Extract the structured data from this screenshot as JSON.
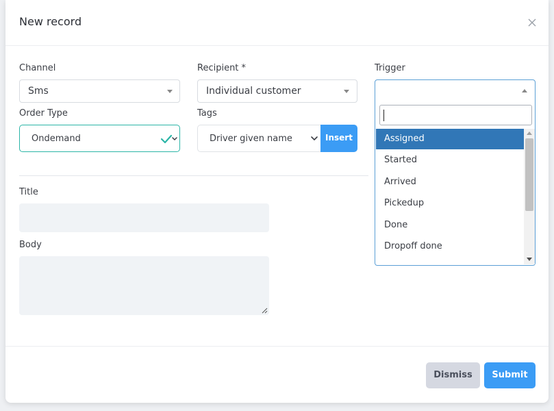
{
  "modal": {
    "title": "New record",
    "close_icon": "close-icon"
  },
  "form": {
    "channel": {
      "label": "Channel",
      "value": "Sms"
    },
    "recipient": {
      "label": "Recipient *",
      "value": "Individual customer"
    },
    "trigger": {
      "label": "Trigger",
      "value": "",
      "search_value": "",
      "options": [
        "Assigned",
        "Started",
        "Arrived",
        "Pickedup",
        "Done",
        "Dropoff done"
      ],
      "highlighted": "Assigned"
    },
    "order_type": {
      "label": "Order Type",
      "value": "Ondemand",
      "valid_icon": "check-icon"
    },
    "tags": {
      "label": "Tags",
      "value": "Driver given name",
      "insert_label": "Insert"
    },
    "title": {
      "label": "Title",
      "value": ""
    },
    "body": {
      "label": "Body",
      "value": ""
    }
  },
  "footer": {
    "dismiss_label": "Dismiss",
    "submit_label": "Submit"
  },
  "colors": {
    "primary": "#3b9cf5",
    "highlight": "#3177b7",
    "valid": "#2bb5a7",
    "dismiss_bg": "#d5d8e1"
  }
}
